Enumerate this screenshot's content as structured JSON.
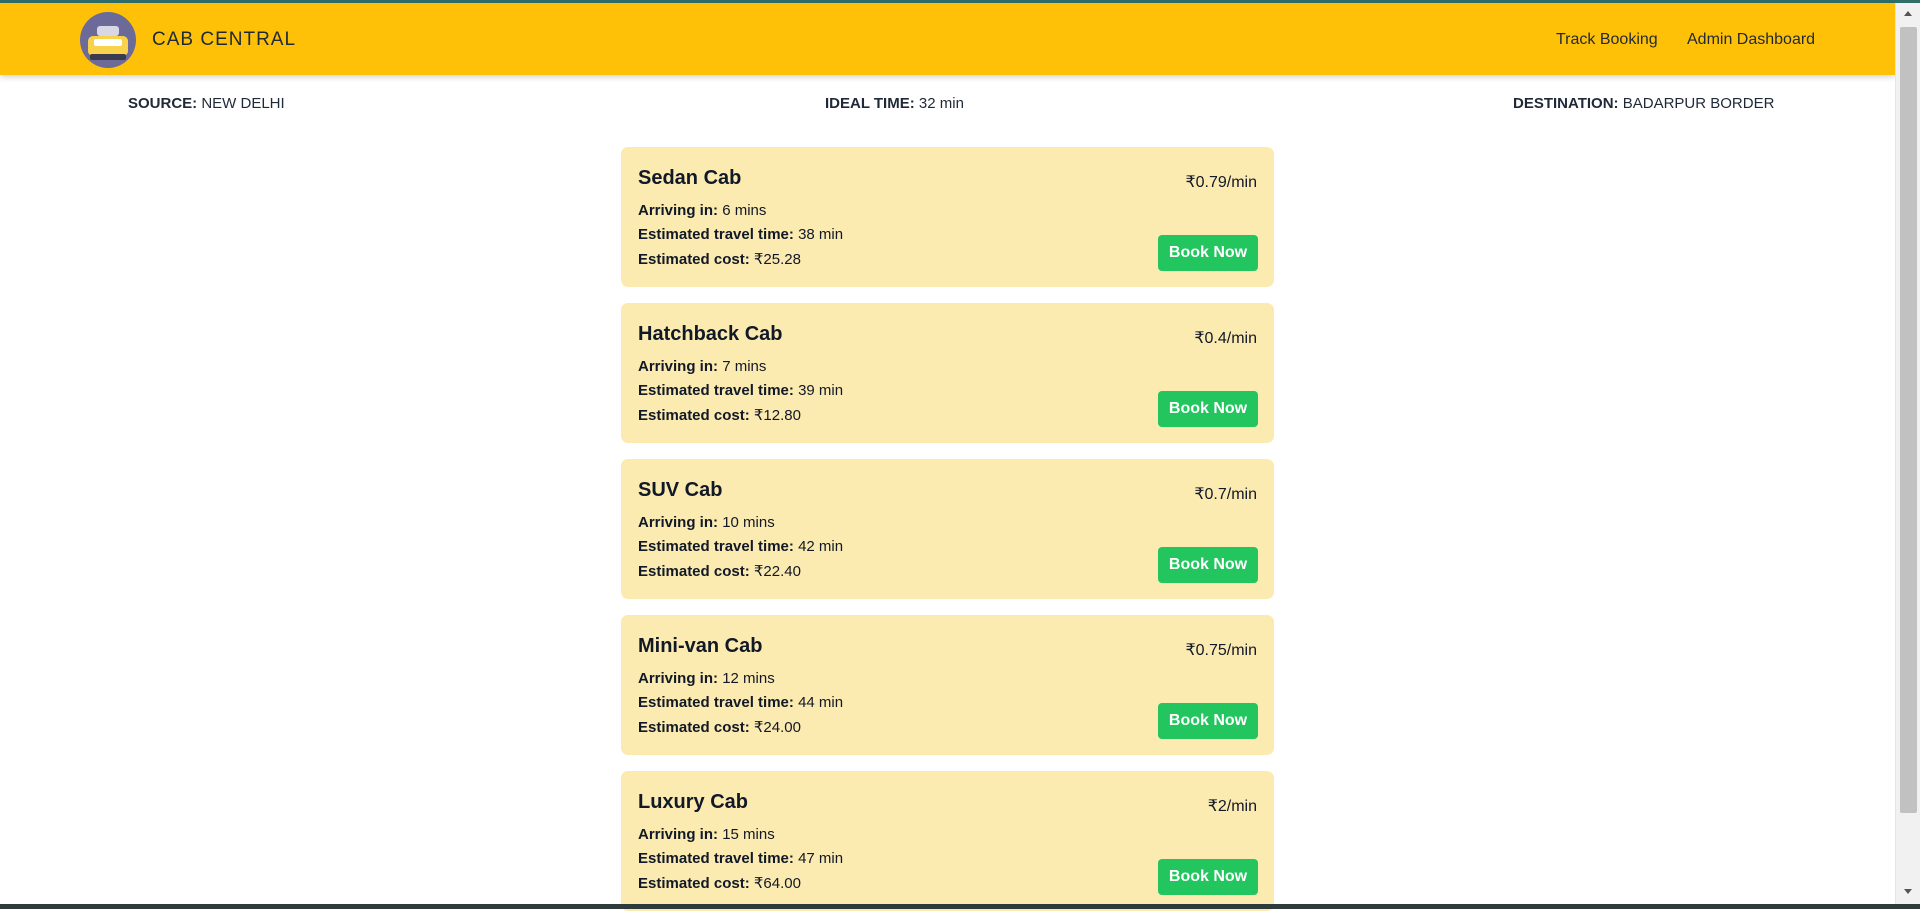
{
  "header": {
    "brand": "CAB CENTRAL",
    "nav": [
      {
        "label": "Track Booking"
      },
      {
        "label": "Admin Dashboard"
      }
    ]
  },
  "trip": {
    "source_label": "SOURCE:",
    "source_value": "NEW DELHI",
    "ideal_label": "IDEAL TIME:",
    "ideal_value": "32 min",
    "destination_label": "DESTINATION:",
    "destination_value": "BADARPUR BORDER"
  },
  "labels": {
    "arriving": "Arriving in:",
    "travel": "Estimated travel time:",
    "cost": "Estimated cost:",
    "book": "Book Now"
  },
  "cabs": [
    {
      "name": "Sedan Cab",
      "rate": "₹0.79/min",
      "arriving": "6 mins",
      "travel": "38 min",
      "cost": "₹25.28"
    },
    {
      "name": "Hatchback Cab",
      "rate": "₹0.4/min",
      "arriving": "7 mins",
      "travel": "39 min",
      "cost": "₹12.80"
    },
    {
      "name": "SUV Cab",
      "rate": "₹0.7/min",
      "arriving": "10 mins",
      "travel": "42 min",
      "cost": "₹22.40"
    },
    {
      "name": "Mini-van Cab",
      "rate": "₹0.75/min",
      "arriving": "12 mins",
      "travel": "44 min",
      "cost": "₹24.00"
    },
    {
      "name": "Luxury Cab",
      "rate": "₹2/min",
      "arriving": "15 mins",
      "travel": "47 min",
      "cost": "₹64.00"
    }
  ],
  "colors": {
    "navbar": "#ffc107",
    "card": "#fcebb0",
    "book_button": "#22c55e"
  },
  "icons": {
    "logo": "taxi-logo-icon"
  }
}
